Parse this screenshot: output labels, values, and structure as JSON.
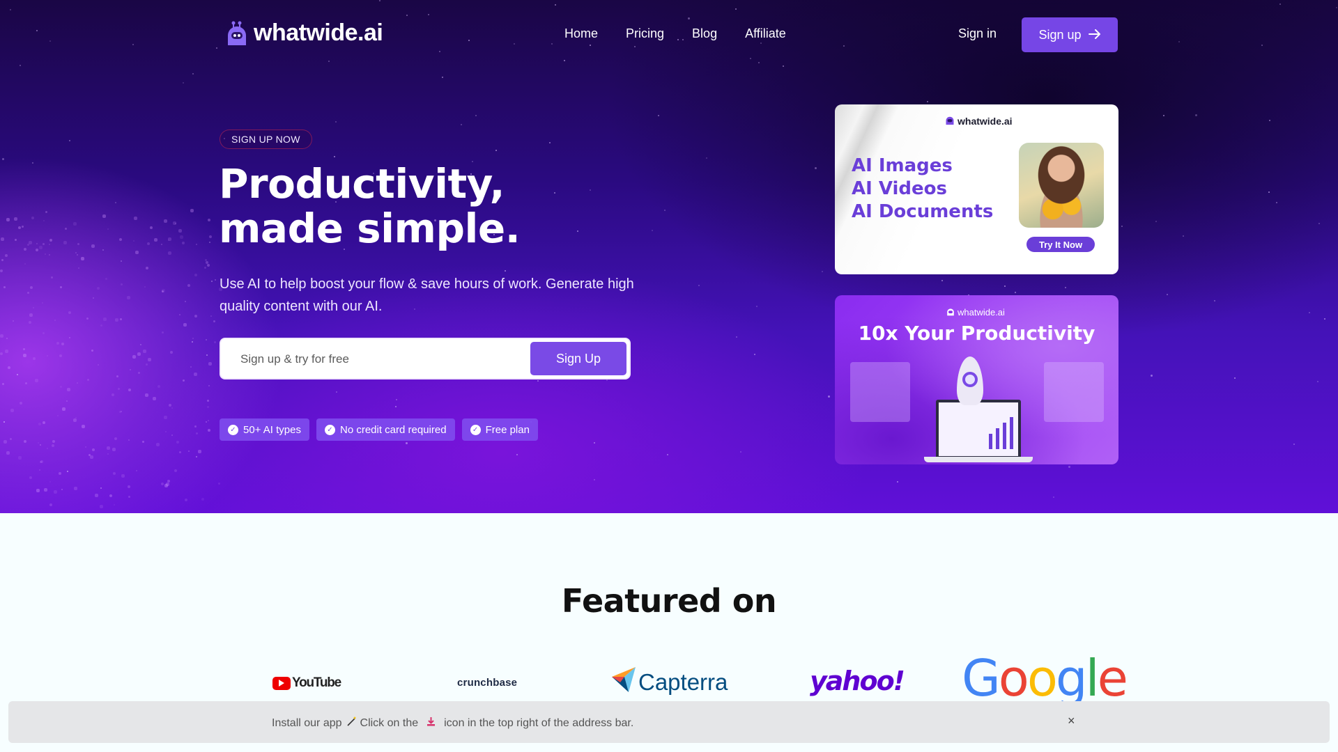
{
  "nav": {
    "logo_text": "whatwide.ai",
    "links": [
      {
        "label": "Home"
      },
      {
        "label": "Pricing"
      },
      {
        "label": "Blog"
      },
      {
        "label": "Affiliate"
      }
    ],
    "sign_in_label": "Sign in",
    "sign_up_label": "Sign up",
    "sign_up_icon": "arrow-right-icon"
  },
  "hero": {
    "badge": "SIGN UP NOW",
    "headline_line1": "Productivity,",
    "headline_line2": "made simple.",
    "subtext": "Use AI to help boost your flow & save hours of work. Generate high quality content with our AI.",
    "form": {
      "placeholder": "Sign up & try for free",
      "value": "",
      "button_label": "Sign Up"
    },
    "features": [
      {
        "icon": "check-circle-icon",
        "label": "50+ AI types"
      },
      {
        "icon": "check-circle-icon",
        "label": "No credit card required"
      },
      {
        "icon": "check-circle-icon",
        "label": "Free plan"
      }
    ]
  },
  "promo_cards": [
    {
      "logo_text": "whatwide.ai",
      "lines": [
        "AI Images",
        "AI Videos",
        "AI Documents"
      ],
      "button_label": "Try It Now"
    },
    {
      "logo_text": "whatwide.ai",
      "title": "10x Your Productivity"
    }
  ],
  "featured": {
    "title": "Featured on",
    "brands": [
      {
        "name": "YouTube"
      },
      {
        "name": "crunchbase"
      },
      {
        "name": "Capterra"
      },
      {
        "name": "yahoo!"
      },
      {
        "name": "Google"
      }
    ]
  },
  "install_bar": {
    "text_before": "Install our app",
    "text_middle": "Click on the",
    "text_after": "icon in the top right of the address bar.",
    "close_label": "×"
  },
  "colors": {
    "accent": "#7646e6",
    "card_text": "#6a3ed8",
    "hero_dark": "#1a0645",
    "page_bg": "#f7feff"
  }
}
